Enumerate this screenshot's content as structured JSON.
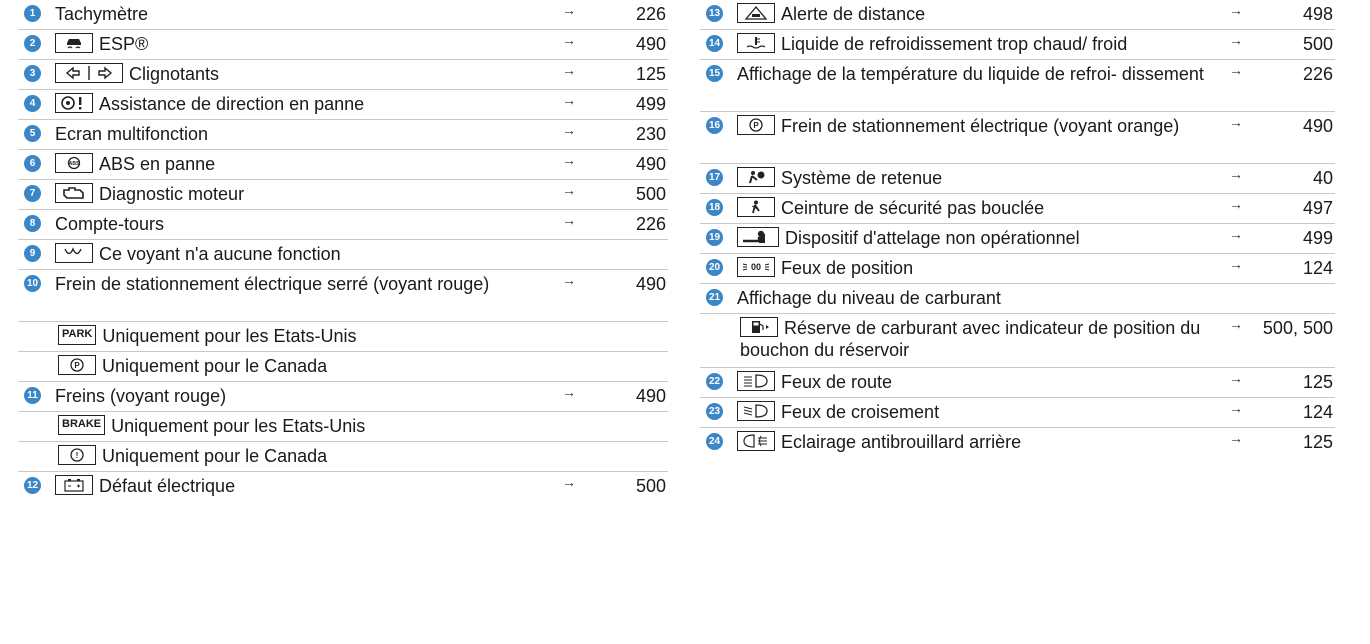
{
  "left": [
    {
      "num": "1",
      "text": "Tachymètre",
      "arrow": "→",
      "page": "226"
    },
    {
      "num": "2",
      "symbol": "esp-car-icon",
      "text": "ESP®",
      "arrow": "→",
      "page": "490"
    },
    {
      "num": "3",
      "symbol": "turn-signal-icons",
      "text": "Clignotants",
      "arrow": "→",
      "page": "125"
    },
    {
      "num": "4",
      "symbol": "steering-warning-icon",
      "text": "Assistance de direction en panne",
      "arrow": "→",
      "page": "499"
    },
    {
      "num": "5",
      "text": "Ecran multifonction",
      "arrow": "→",
      "page": "230"
    },
    {
      "num": "6",
      "symbol": "abs-icon",
      "text": "ABS en panne",
      "arrow": "→",
      "page": "490"
    },
    {
      "num": "7",
      "symbol": "engine-icon",
      "text": "Diagnostic moteur",
      "arrow": "→",
      "page": "500"
    },
    {
      "num": "8",
      "text": "Compte-tours",
      "arrow": "→",
      "page": "226"
    },
    {
      "num": "9",
      "symbol": "glow-plug-icon",
      "text": "Ce voyant n'a aucune fonction"
    },
    {
      "num": "10",
      "text": "Frein de stationnement électrique serré (voyant rouge)",
      "arrow": "→",
      "page": "490"
    },
    {
      "symbol_text": "PARK",
      "text": "Uniquement pour les Etats-Unis"
    },
    {
      "symbol": "parking-brake-circle-icon",
      "text": "Uniquement pour le Canada"
    },
    {
      "num": "11",
      "text": "Freins (voyant rouge)",
      "arrow": "→",
      "page": "490"
    },
    {
      "symbol_text": "BRAKE",
      "text": "Uniquement pour les Etats-Unis"
    },
    {
      "symbol": "brake-warning-circle-icon",
      "text": "Uniquement pour le Canada"
    },
    {
      "num": "12",
      "symbol": "battery-icon",
      "text": "Défaut électrique",
      "arrow": "→",
      "page": "500"
    }
  ],
  "right": [
    {
      "num": "13",
      "symbol": "distance-warning-icon",
      "text": "Alerte de distance",
      "arrow": "→",
      "page": "498"
    },
    {
      "num": "14",
      "symbol": "coolant-icon",
      "text": "Liquide de refroidissement trop chaud/ froid",
      "arrow": "→",
      "page": "500"
    },
    {
      "num": "15",
      "text": "Affichage de la température du liquide de refroi- dissement",
      "arrow": "→",
      "page": "226"
    },
    {
      "num": "16",
      "symbol": "parking-brake-circle-icon",
      "text": "Frein de stationnement électrique (voyant orange)",
      "arrow": "→",
      "page": "490"
    },
    {
      "num": "17",
      "symbol": "airbag-icon",
      "text": "Système de retenue",
      "arrow": "→",
      "page": "40"
    },
    {
      "num": "18",
      "symbol": "seatbelt-icon",
      "text": "Ceinture de sécurité pas bouclée",
      "arrow": "→",
      "page": "497"
    },
    {
      "num": "19",
      "symbol": "trailer-hitch-icon",
      "text": "Dispositif d'attelage non opérationnel",
      "arrow": "→",
      "page": "499"
    },
    {
      "num": "20",
      "symbol": "position-lamps-icon",
      "text": "Feux de position",
      "arrow": "→",
      "page": "124"
    },
    {
      "num": "21",
      "text": "Affichage du niveau de carburant"
    },
    {
      "symbol": "fuel-pump-icon",
      "text": "Réserve de carburant avec indicateur de position du bouchon du réservoir",
      "arrow": "→",
      "page": "500, 500"
    },
    {
      "num": "22",
      "symbol": "high-beam-icon",
      "text": "Feux de route",
      "arrow": "→",
      "page": "125"
    },
    {
      "num": "23",
      "symbol": "low-beam-icon",
      "text": "Feux de croisement",
      "arrow": "→",
      "page": "124"
    },
    {
      "num": "24",
      "symbol": "rear-fog-icon",
      "text": "Eclairage antibrouillard arrière",
      "arrow": "→",
      "page": "125"
    }
  ]
}
